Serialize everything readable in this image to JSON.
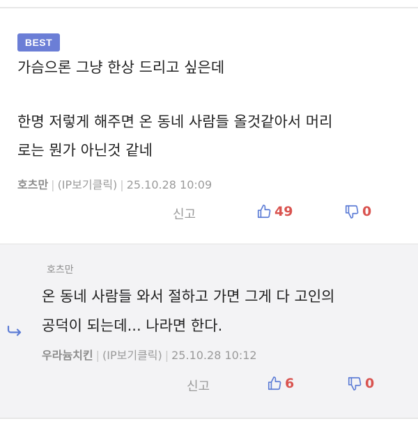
{
  "main_comment": {
    "badge": "BEST",
    "lines": [
      "가슴으론 그냥 한상 드리고 싶은데",
      "한명 저렇게 해주면 온 동네 사람들 올것같아서 머리",
      "로는 뭔가 아닌것 같네"
    ],
    "author": "호츠만",
    "ip": "(IP보기클릭)",
    "timestamp": "25.10.28 10:09",
    "report_label": "신고",
    "likes": "49",
    "dislikes": "0"
  },
  "reply_comment": {
    "reply_to": "호츠만",
    "lines": [
      "온 동네 사람들 와서 절하고 가면 그게 다 고인의",
      "공덕이 되는데... 나라면 한다."
    ],
    "author": "우라늄치킨",
    "ip": "(IP보기클릭)",
    "timestamp": "25.10.28 10:12",
    "report_label": "신고",
    "likes": "6",
    "dislikes": "0"
  },
  "colors": {
    "badge_bg": "#6b7ed6",
    "thumb_icon": "#5b7bd5",
    "count_text": "#d9534f",
    "reply_bg": "#f3f3f5"
  },
  "icons": [
    "thumbs-up-icon",
    "thumbs-down-icon",
    "reply-arrow-icon"
  ]
}
